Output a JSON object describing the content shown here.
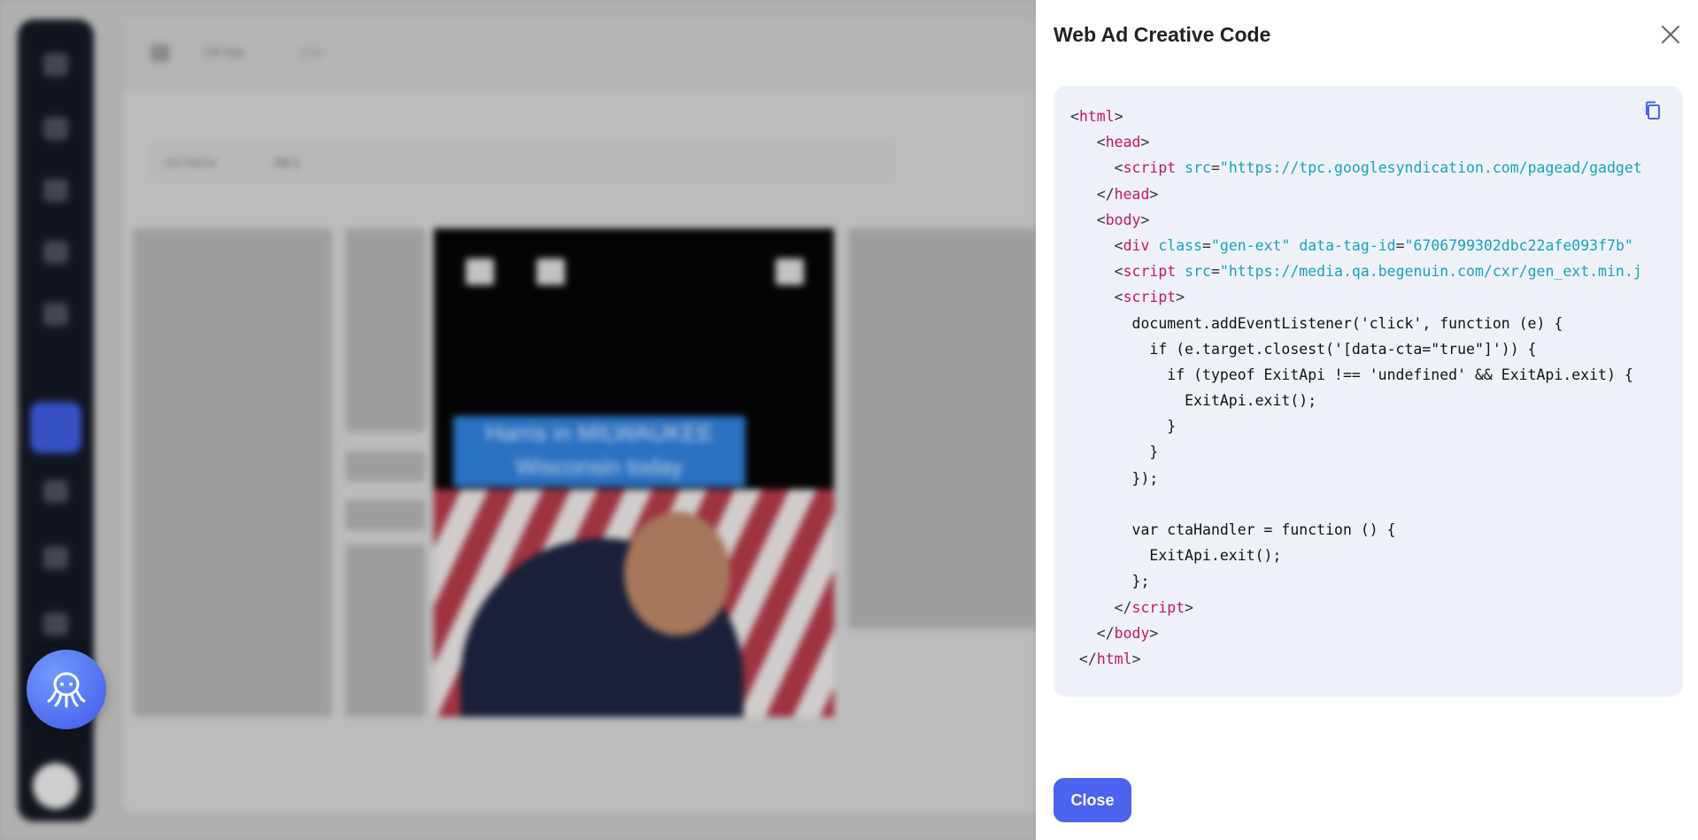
{
  "drawer": {
    "title": "Web Ad Creative Code",
    "close_label": "Close",
    "copy_icon": "copy-icon",
    "close_icon": "close-icon"
  },
  "background": {
    "ad_caption": "Harris in MILWAUKEE Wisconsin today",
    "breadcrumb": [
      "Off Site",
      "Edit"
    ],
    "ad_name_label": "Ad Name",
    "ad_name_value": "Ad 1"
  },
  "colors": {
    "accent": "#4c62f0",
    "code_bg": "#eef2f8",
    "tag": "#c2185b",
    "attr": "#17a2b8"
  },
  "code": [
    [
      {
        "t": "p",
        "v": "<"
      },
      {
        "t": "t",
        "v": "html"
      },
      {
        "t": "p",
        "v": ">"
      }
    ],
    [
      {
        "t": "p",
        "v": "   <"
      },
      {
        "t": "t",
        "v": "head"
      },
      {
        "t": "p",
        "v": ">"
      }
    ],
    [
      {
        "t": "p",
        "v": "     <"
      },
      {
        "t": "t",
        "v": "script"
      },
      {
        "t": "p",
        "v": " "
      },
      {
        "t": "a",
        "v": "src"
      },
      {
        "t": "p",
        "v": "="
      },
      {
        "t": "s",
        "v": "\"https://tpc.googlesyndication.com/pagead/gadget"
      }
    ],
    [
      {
        "t": "p",
        "v": "   </"
      },
      {
        "t": "t",
        "v": "head"
      },
      {
        "t": "p",
        "v": ">"
      }
    ],
    [
      {
        "t": "p",
        "v": "   <"
      },
      {
        "t": "t",
        "v": "body"
      },
      {
        "t": "p",
        "v": ">"
      }
    ],
    [
      {
        "t": "p",
        "v": "     <"
      },
      {
        "t": "t",
        "v": "div"
      },
      {
        "t": "p",
        "v": " "
      },
      {
        "t": "a",
        "v": "class"
      },
      {
        "t": "p",
        "v": "="
      },
      {
        "t": "s",
        "v": "\"gen-ext\""
      },
      {
        "t": "p",
        "v": " "
      },
      {
        "t": "a",
        "v": "data-tag-id"
      },
      {
        "t": "p",
        "v": "="
      },
      {
        "t": "s",
        "v": "\"6706799302dbc22afe093f7b\""
      }
    ],
    [
      {
        "t": "p",
        "v": "     <"
      },
      {
        "t": "t",
        "v": "script"
      },
      {
        "t": "p",
        "v": " "
      },
      {
        "t": "a",
        "v": "src"
      },
      {
        "t": "p",
        "v": "="
      },
      {
        "t": "s",
        "v": "\"https://media.qa.begenuin.com/cxr/gen_ext.min.j"
      }
    ],
    [
      {
        "t": "p",
        "v": "     <"
      },
      {
        "t": "t",
        "v": "script"
      },
      {
        "t": "p",
        "v": ">"
      }
    ],
    [
      {
        "t": "n",
        "v": "       document.addEventListener('click', function (e) {"
      }
    ],
    [
      {
        "t": "n",
        "v": "         if (e.target.closest('[data-cta=\"true\"]')) {"
      }
    ],
    [
      {
        "t": "n",
        "v": "           if (typeof ExitApi !== 'undefined' && ExitApi.exit) {"
      }
    ],
    [
      {
        "t": "n",
        "v": "             ExitApi.exit();"
      }
    ],
    [
      {
        "t": "n",
        "v": "           }"
      }
    ],
    [
      {
        "t": "n",
        "v": "         }"
      }
    ],
    [
      {
        "t": "n",
        "v": "       });"
      }
    ],
    [
      {
        "t": "n",
        "v": ""
      }
    ],
    [
      {
        "t": "n",
        "v": "       var ctaHandler = function () {"
      }
    ],
    [
      {
        "t": "n",
        "v": "         ExitApi.exit();"
      }
    ],
    [
      {
        "t": "n",
        "v": "       };"
      }
    ],
    [
      {
        "t": "p",
        "v": "     </"
      },
      {
        "t": "t",
        "v": "script"
      },
      {
        "t": "p",
        "v": ">"
      }
    ],
    [
      {
        "t": "p",
        "v": "   </"
      },
      {
        "t": "t",
        "v": "body"
      },
      {
        "t": "p",
        "v": ">"
      }
    ],
    [
      {
        "t": "p",
        "v": " </"
      },
      {
        "t": "t",
        "v": "html"
      },
      {
        "t": "p",
        "v": ">"
      }
    ]
  ]
}
